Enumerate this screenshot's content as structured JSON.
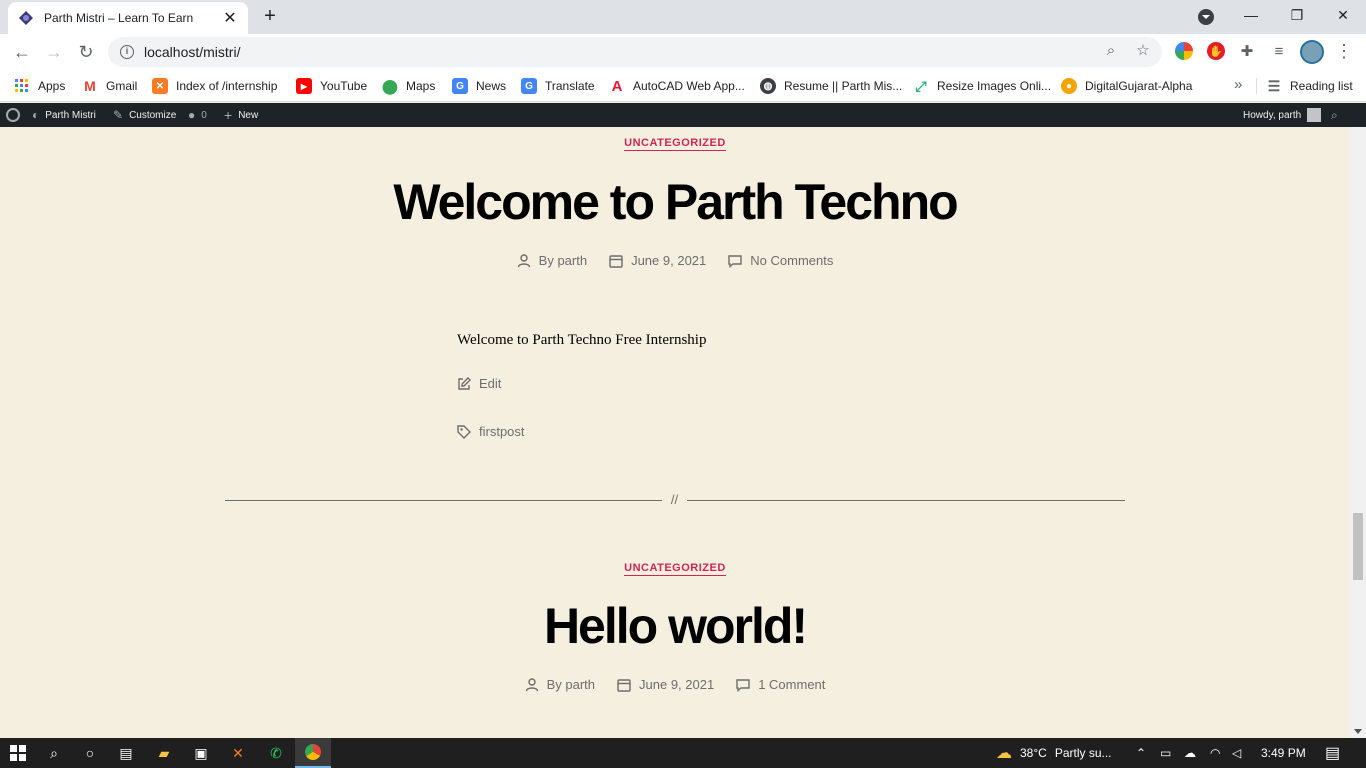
{
  "browser": {
    "tab_title": "Parth Mistri – Learn To Earn",
    "url": "localhost/mistri/",
    "bookmarks": [
      {
        "label": "Apps",
        "icon": "apps-grid-icon",
        "color": "#4285f4"
      },
      {
        "label": "Gmail",
        "icon": "gmail-icon",
        "color": "#ea4335"
      },
      {
        "label": "Index of /internship",
        "icon": "xampp-icon",
        "color": "#fb7a24"
      },
      {
        "label": "YouTube",
        "icon": "youtube-icon",
        "color": "#ff0000"
      },
      {
        "label": "Maps",
        "icon": "maps-pin-icon",
        "color": "#34a853"
      },
      {
        "label": "News",
        "icon": "news-icon",
        "color": "#4285f4"
      },
      {
        "label": "Translate",
        "icon": "translate-icon",
        "color": "#4285f4"
      },
      {
        "label": "AutoCAD Web App...",
        "icon": "autocad-icon",
        "color": "#e51937"
      },
      {
        "label": "Resume || Parth Mis...",
        "icon": "globe-icon",
        "color": "#3c4043"
      },
      {
        "label": "Resize Images Onli...",
        "icon": "resize-icon",
        "color": "#2bb673"
      },
      {
        "label": "DigitalGujarat-Alpha",
        "icon": "digitalgujarat-icon",
        "color": "#f4a300"
      }
    ],
    "reading_list": "Reading list"
  },
  "adminbar": {
    "site_name": "Parth Mistri",
    "customize": "Customize",
    "comments_count": "0",
    "new": "New",
    "howdy": "Howdy, parth"
  },
  "posts": [
    {
      "category": "UNCATEGORIZED",
      "title": "Welcome to Parth Techno",
      "author": "By parth",
      "date": "June 9, 2021",
      "comments": "No Comments",
      "excerpt": "Welcome to Parth Techno Free Internship",
      "edit": "Edit",
      "tag": "firstpost"
    },
    {
      "category": "UNCATEGORIZED",
      "title": "Hello world!",
      "author": "By parth",
      "date": "June 9, 2021",
      "comments": "1 Comment"
    }
  ],
  "separator": "//",
  "taskbar": {
    "weather_temp": "38°C",
    "weather_desc": "Partly su...",
    "time": "3:49 PM"
  },
  "colors": {
    "accent": "#cd2653",
    "background": "#f5efe0",
    "adminbar": "#1d2327"
  }
}
